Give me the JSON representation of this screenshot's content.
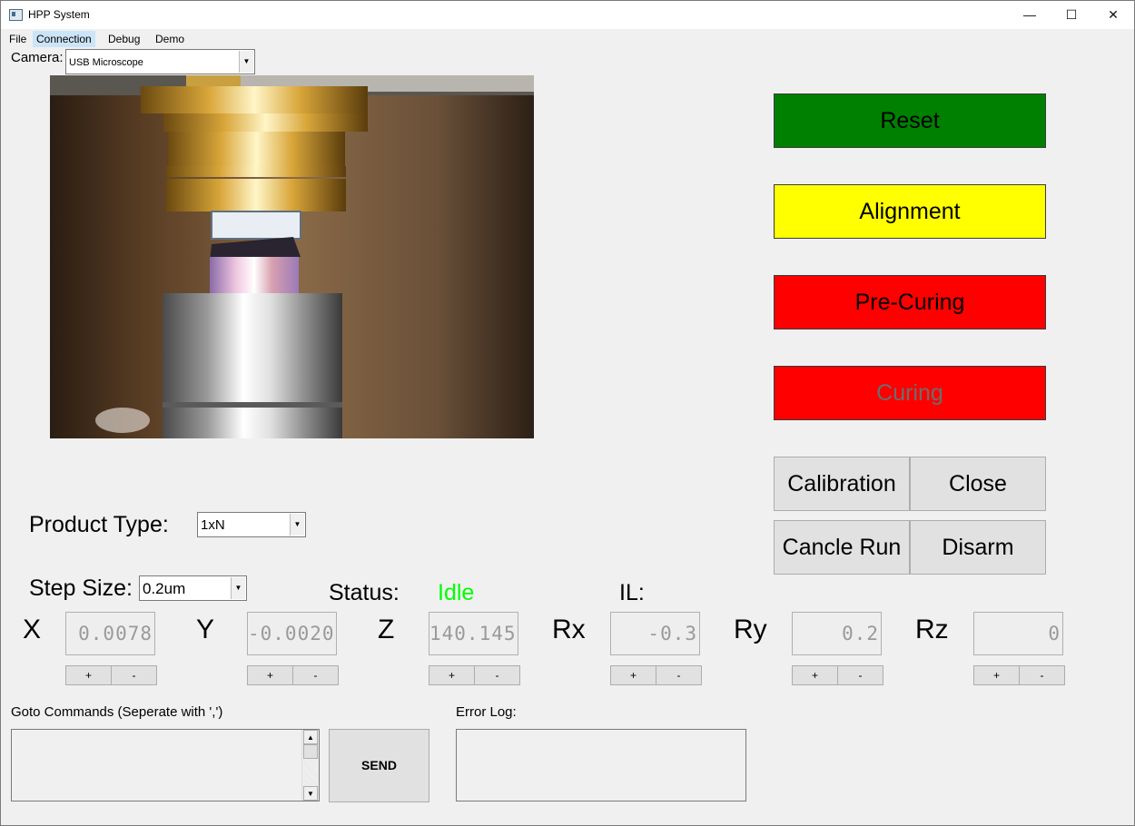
{
  "window": {
    "title": "HPP System",
    "minimize_glyph": "—",
    "maximize_glyph": "☐",
    "close_glyph": "✕"
  },
  "menu": [
    "File",
    "Connection",
    "Debug",
    "Demo"
  ],
  "camera": {
    "label": "Camera:",
    "selected": "USB Microscope"
  },
  "buttons": {
    "reset": "Reset",
    "alignment": "Alignment",
    "pre_curing": "Pre-Curing",
    "curing": "Curing",
    "calibration": "Calibration",
    "close": "Close",
    "cancel_run": "Cancle Run",
    "disarm": "Disarm",
    "send": "SEND"
  },
  "colors": {
    "reset": "#008000",
    "alignment": "#ffff00",
    "pre_curing": "#ff0000",
    "curing": "#ff0000",
    "curing_text_disabled": "#6d6d6d",
    "status_idle": "#00ff00"
  },
  "product_type": {
    "label": "Product Type:",
    "selected": "1xN"
  },
  "step_size": {
    "label": "Step Size:",
    "selected": "0.2um"
  },
  "status": {
    "label": "Status:",
    "value": "Idle",
    "il_label": "IL:"
  },
  "axes": [
    {
      "name": "X",
      "value": "0.0078"
    },
    {
      "name": "Y",
      "value": "-0.00205"
    },
    {
      "name": "Z",
      "value": "140.1451"
    },
    {
      "name": "Rx",
      "value": "-0.3"
    },
    {
      "name": "Ry",
      "value": "0.2"
    },
    {
      "name": "Rz",
      "value": "0"
    }
  ],
  "step_buttons": {
    "plus": "+",
    "minus": "-"
  },
  "goto": {
    "label": "Goto Commands (Seperate with ',')",
    "value": ""
  },
  "error_log": {
    "label": "Error Log:",
    "value": ""
  },
  "scroll": {
    "up": "▲",
    "down": "▼"
  },
  "combo_arrow": "▼"
}
